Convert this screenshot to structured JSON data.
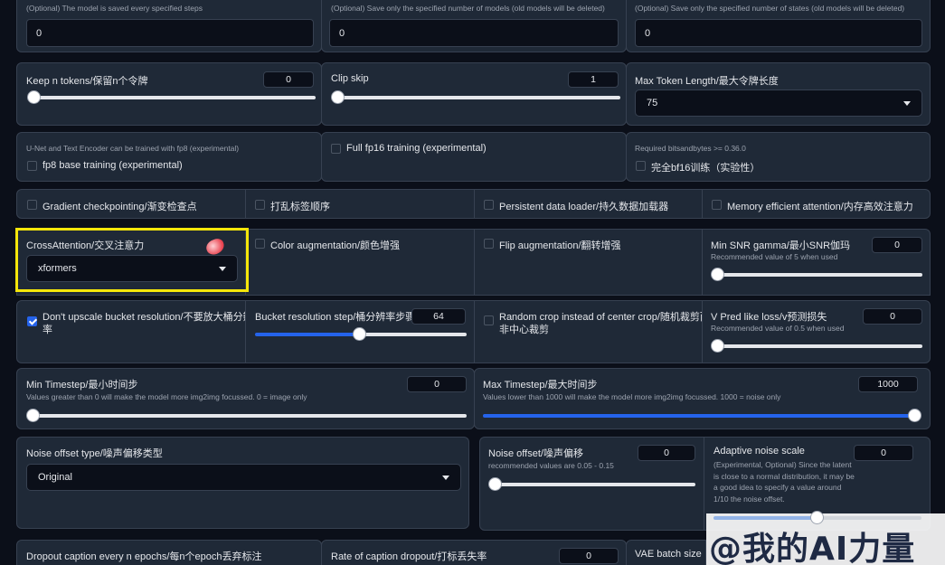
{
  "top": {
    "save_every": {
      "hint": "(Optional) The model is saved every specified steps",
      "value": "0"
    },
    "save_models": {
      "hint": "(Optional) Save only the specified number of models (old models will be deleted)",
      "value": "0"
    },
    "save_states": {
      "hint": "(Optional) Save only the specified number of states (old models will be deleted)",
      "value": "0"
    }
  },
  "keep_tokens": {
    "label": "Keep n tokens/保留n个令牌",
    "value": "0",
    "level": 0
  },
  "clip_skip": {
    "label": "Clip skip",
    "value": "1",
    "level": 0
  },
  "max_token": {
    "label": "Max Token Length/最大令牌长度",
    "value": "75"
  },
  "fp8": {
    "hint": "U-Net and Text Encoder can be trained with fp8 (experimental)",
    "label": "fp8 base training (experimental)",
    "checked": false
  },
  "fp16": {
    "label": "Full fp16 training (experimental)",
    "checked": false
  },
  "bf16": {
    "hint": "Required bitsandbytes >= 0.36.0",
    "label": "完全bf16训练（实验性）",
    "checked": false
  },
  "row4": {
    "gradient": "Gradient checkpointing/渐变检查点",
    "shuffle": "打乱标签顺序",
    "persistent": "Persistent data loader/持久数据加载器",
    "memory": "Memory efficient attention/内存高效注意力"
  },
  "cross_attention": {
    "label": "CrossAttention/交叉注意力",
    "value": "xformers"
  },
  "color_aug": "Color augmentation/颜色增强",
  "flip_aug": "Flip augmentation/翻转增强",
  "min_snr": {
    "label": "Min SNR gamma/最小SNR伽玛",
    "hint": "Recommended value of 5 when used",
    "value": "0",
    "level": 0
  },
  "dont_upscale": {
    "label_line1": "Don't upscale bucket resolution/不要放大桶分辨",
    "label_line2": "率",
    "checked": true
  },
  "bucket_step": {
    "label": "Bucket resolution step/桶分辨率步骤",
    "value": "64",
    "level": 0.5
  },
  "random_crop": {
    "label_line1": "Random crop instead of center crop/随机裁剪而",
    "label_line2": "非中心裁剪"
  },
  "vpred": {
    "label": "V Pred like loss/v预测损失",
    "hint": "Recommended value of 0.5 when used",
    "value": "0",
    "level": 0
  },
  "min_timestep": {
    "label": "Min Timestep/最小时间步",
    "hint": "Values greater than 0 will make the model more img2img focussed. 0 = image only",
    "value": "0",
    "level": 0
  },
  "max_timestep": {
    "label": "Max Timestep/最大时间步",
    "hint": "Values lower than 1000 will make the model more img2img focussed. 1000 = noise only",
    "value": "1000",
    "level": 1
  },
  "noise_type": {
    "label": "Noise offset type/噪声偏移类型",
    "value": "Original"
  },
  "noise_offset": {
    "label": "Noise offset/噪声偏移",
    "hint": "recommended values are 0.05 - 0.15",
    "value": "0",
    "level": 0
  },
  "adaptive": {
    "label": "Adaptive noise scale",
    "hint": "(Experimental, Optional) Since the latent is close to a normal distribution, it may be a good idea to specify a value around 1/10 the noise offset.",
    "value": "0"
  },
  "dropout_epochs": {
    "label": "Dropout caption every n epochs/每n个epoch丢弃标注"
  },
  "rate_dropout": {
    "label": "Rate of caption dropout/打标丢失率",
    "value": "0"
  },
  "vae_batch": {
    "label": "VAE batch size"
  },
  "watermark": "@我的AI力量"
}
